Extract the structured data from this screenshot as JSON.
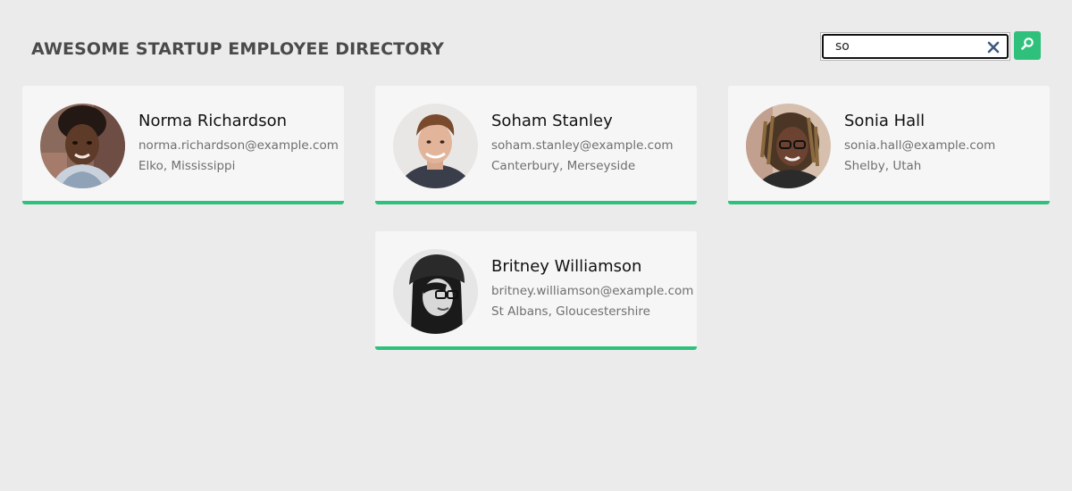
{
  "header": {
    "title": "AWESOME STARTUP EMPLOYEE DIRECTORY"
  },
  "search": {
    "value": "so",
    "placeholder": "",
    "clear_icon": "close-icon",
    "submit_icon": "search-icon"
  },
  "colors": {
    "accent": "#2fc17c",
    "background": "#ebebeb",
    "card": "#f6f6f6"
  },
  "employees": [
    {
      "name": "Norma Richardson",
      "email": "norma.richardson@example.com",
      "location": "Elko, Mississippi"
    },
    {
      "name": "Soham Stanley",
      "email": "soham.stanley@example.com",
      "location": "Canterbury, Merseyside"
    },
    {
      "name": "Sonia Hall",
      "email": "sonia.hall@example.com",
      "location": "Shelby, Utah"
    },
    {
      "name": "Britney Williamson",
      "email": "britney.williamson@example.com",
      "location": "St Albans, Gloucestershire"
    }
  ]
}
